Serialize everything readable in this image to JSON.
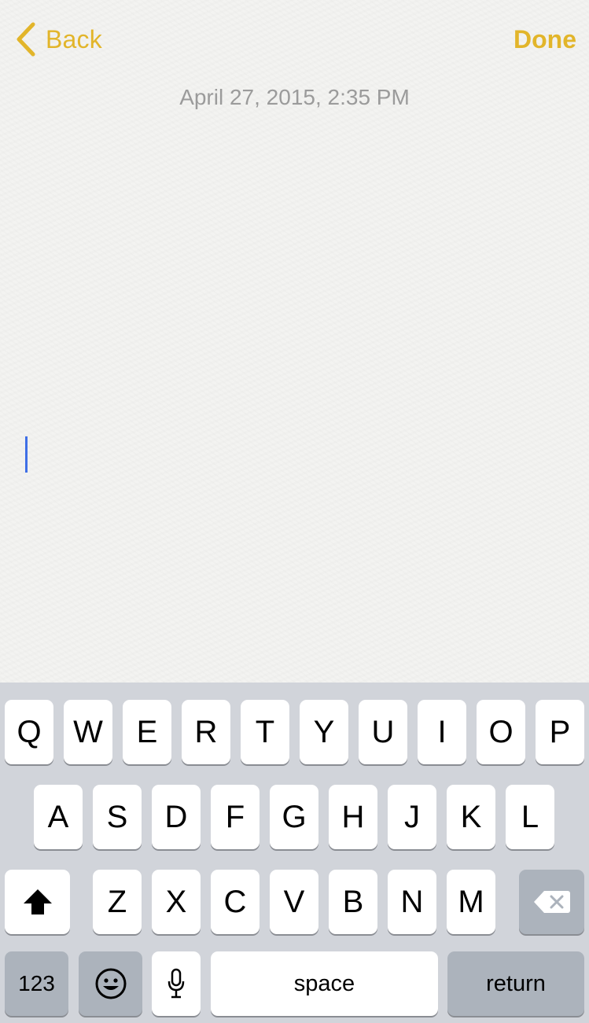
{
  "nav": {
    "back_label": "Back",
    "done_label": "Done",
    "accent_color": "#e2b52a"
  },
  "note": {
    "date": "April 27, 2015, 2:35 PM",
    "body": ""
  },
  "keyboard": {
    "row1": [
      "Q",
      "W",
      "E",
      "R",
      "T",
      "Y",
      "U",
      "I",
      "O",
      "P"
    ],
    "row2": [
      "A",
      "S",
      "D",
      "F",
      "G",
      "H",
      "J",
      "K",
      "L"
    ],
    "row3": [
      "Z",
      "X",
      "C",
      "V",
      "B",
      "N",
      "M"
    ],
    "shift_icon": "shift-arrow-icon",
    "delete_icon": "backspace-icon",
    "numbers_label": "123",
    "emoji_icon": "smiley-icon",
    "mic_icon": "microphone-icon",
    "space_label": "space",
    "return_label": "return"
  }
}
